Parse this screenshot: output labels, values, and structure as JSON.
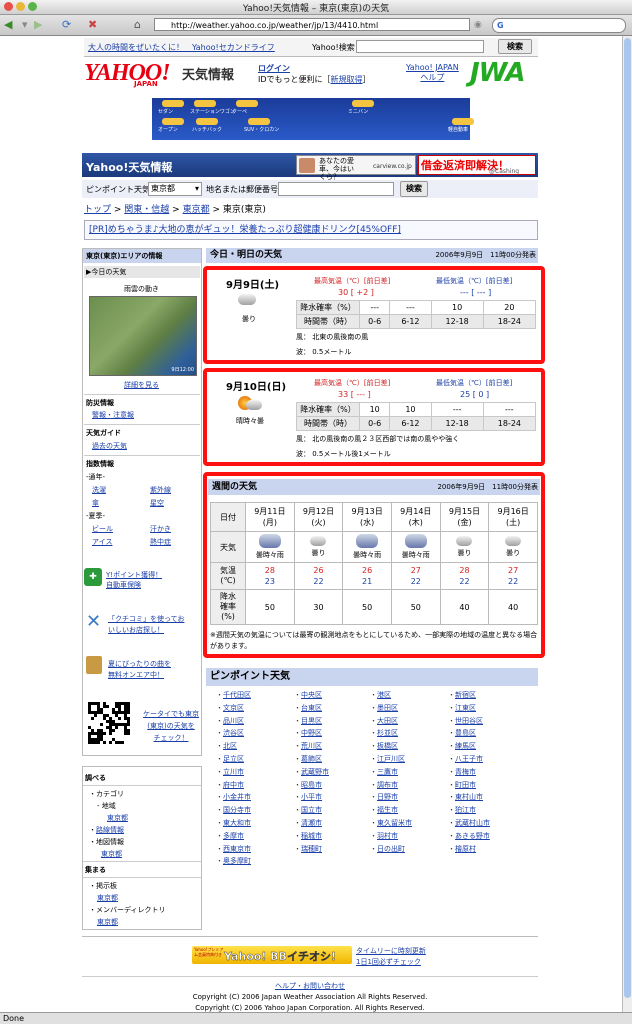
{
  "window": {
    "title": "Yahoo!天気情報 – 東京(東京)の天気",
    "url": "http://weather.yahoo.co.jp/weather/jp/13/4410.html"
  },
  "status": "Done",
  "top": {
    "link1": "大人の時間をぜいたくに！　Yahoo!セカンドライフ",
    "search_label": "Yahoo!検索",
    "search_button": "検索"
  },
  "header": {
    "logo": "YAHOO!",
    "logo_sub": "JAPAN",
    "service": "天気情報",
    "login": "ログイン",
    "login_sub": "IDでもっと便利に［",
    "signup": "新規取得",
    "login_end": "］",
    "links": [
      "Yahoo! JAPAN",
      "ヘルプ"
    ],
    "jwa": "JWA"
  },
  "banner_cars": [
    "セダン",
    "ステーションワゴン",
    "クーペ",
    "ミニバン",
    "オープン",
    "ハッチバック",
    "SUV・クロカン",
    "軽自動車"
  ],
  "bar": {
    "title": "Yahoo!天気情報",
    "ad1": "あなたの愛車、今はいくら？",
    "ad1_brand": "carview.co.jp",
    "ad2": "借金返済即解決！",
    "ad2_sub": "@Cashing"
  },
  "pinpoint": {
    "label": "ピンポイント天気",
    "select": "東京都",
    "search_label": "地名または郵便番号",
    "button": "検索"
  },
  "breadcrumb": [
    "トップ",
    "関東・信越",
    "東京都",
    "東京(東京)"
  ],
  "pr": "[PR]めちゃうま♪大地の恵がギュッ！栄養たっぷり超健康ドリンク[45%OFF]",
  "side": {
    "area_title": "東京(東京)エリアの情報",
    "today": "▶今日の天気",
    "cloud": "雨雲の動き",
    "radar_time": "9日12:00",
    "detail": "詳細を見る",
    "bousai": "防災情報",
    "keihou": "警報・注意報",
    "guide": "天気ガイド",
    "past": "過去の天気",
    "index": "指数情報",
    "year": "-通年-",
    "sentaku": "洗濯",
    "shigaisen": "紫外線",
    "kasa": "傘",
    "hoshizora": "星空",
    "summer": "-夏季-",
    "beer": "ビール",
    "asemo": "汗かき",
    "ice": "アイス",
    "necchu": "熱中症",
    "promo1a": "Y!ポイント獲得！",
    "promo1b": "自動車保険",
    "promo2a": "「クチコミ」を使ってお",
    "promo2b": "いしいお店探し！",
    "promo3a": "夏にぴったりの曲を",
    "promo3b": "無料オンエア中！",
    "qr_text1": "ケータイでも東京",
    "qr_text2": "(東京)の天気を",
    "qr_text3": "チェック！",
    "search_title": "調べる",
    "category": "・カテゴリ",
    "region": "- 地域",
    "tokyo1": "東京都",
    "rosen": "路線情報",
    "chizu": "地図情報",
    "tokyo2": "東京都",
    "gather": "集まる",
    "bbs": "・掲示板",
    "tokyo3": "東京都",
    "member": "・メンバーディレクトリ",
    "tokyo4": "東京都"
  },
  "today_header": {
    "title": "今日・明日の天気",
    "date": "2006年9月9日　11時00分発表"
  },
  "days": [
    {
      "date": "9月9日(土)",
      "weather": "曇り",
      "hi_label": "最高気温（℃）[前日差]",
      "hi": "30 [ +2 ]",
      "lo_label": "最低気温（℃）[前日差]",
      "lo": "--- [ --- ]",
      "rain_label": "降水確率（%）",
      "rain": [
        "---",
        "---",
        "10",
        "20"
      ],
      "time_label": "時間帯（時）",
      "times": [
        "0-6",
        "6-12",
        "12-18",
        "18-24"
      ],
      "wind": "風：  北東の風後南の風",
      "wave": "波：  0.5メートル"
    },
    {
      "date": "9月10日(日)",
      "weather": "晴時々曇",
      "hi_label": "最高気温（℃）[前日差]",
      "hi": "33 [ --- ]",
      "lo_label": "最低気温（℃）[前日差]",
      "lo": "25 [ 0 ]",
      "rain_label": "降水確率（%）",
      "rain": [
        "10",
        "10",
        "---",
        "---"
      ],
      "time_label": "時間帯（時）",
      "times": [
        "0-6",
        "6-12",
        "12-18",
        "18-24"
      ],
      "wind": "風：  北の風後南の風２３区西部では南の風やや強く",
      "wave": "波：  0.5メートル後1メートル"
    }
  ],
  "weekly": {
    "title": "週間の天気",
    "date": "2006年9月9日　11時00分発表",
    "row_date": "日付",
    "row_weather": "天気",
    "row_temp": "気温\n(℃)",
    "row_rain": "降水\n確率\n(%)",
    "days": [
      {
        "d": "9月11日",
        "w": "(月)",
        "wx": "曇時々雨",
        "hi": "28",
        "lo": "23",
        "rain": "50",
        "icon": "thunder"
      },
      {
        "d": "9月12日",
        "w": "(火)",
        "wx": "曇り",
        "hi": "26",
        "lo": "22",
        "rain": "30",
        "icon": "cloud"
      },
      {
        "d": "9月13日",
        "w": "(水)",
        "wx": "曇時々雨",
        "hi": "26",
        "lo": "21",
        "rain": "50",
        "icon": "thunder"
      },
      {
        "d": "9月14日",
        "w": "(木)",
        "wx": "曇時々雨",
        "hi": "27",
        "lo": "22",
        "rain": "50",
        "icon": "thunder"
      },
      {
        "d": "9月15日",
        "w": "(金)",
        "wx": "曇り",
        "hi": "28",
        "lo": "22",
        "rain": "40",
        "icon": "cloud"
      },
      {
        "d": "9月16日",
        "w": "(土)",
        "wx": "曇り",
        "hi": "27",
        "lo": "22",
        "rain": "40",
        "icon": "cloud"
      }
    ],
    "note": "※週間天気の気温については最寄の観測地点をもとにしているため、一部実際の地域の温度と異なる場合があります。"
  },
  "pin_header": "ピンポイント天気",
  "pin_cols": [
    [
      "千代田区",
      "文京区",
      "品川区",
      "渋谷区",
      "北区",
      "足立区",
      "立川市",
      "府中市",
      "小金井市",
      "国分寺市",
      "東大和市",
      "多摩市",
      "西東京市",
      "奥多摩町"
    ],
    [
      "中央区",
      "台東区",
      "目黒区",
      "中野区",
      "荒川区",
      "葛飾区",
      "武蔵野市",
      "昭島市",
      "小平市",
      "国立市",
      "清瀬市",
      "稲城市",
      "瑞穂町"
    ],
    [
      "港区",
      "墨田区",
      "大田区",
      "杉並区",
      "板橋区",
      "江戸川区",
      "三鷹市",
      "調布市",
      "日野市",
      "福生市",
      "東久留米市",
      "羽村市",
      "日の出町"
    ],
    [
      "新宿区",
      "江東区",
      "世田谷区",
      "豊島区",
      "練馬区",
      "八王子市",
      "青梅市",
      "町田市",
      "東村山市",
      "狛江市",
      "武蔵村山市",
      "あきる野市",
      "檜原村"
    ]
  ],
  "footer": {
    "bb": "Yahoo! BBイチオシ!",
    "bb_sub": "Yahoo!プレミアム会員特典付き",
    "bb_link1": "タイムリーに時刻更新",
    "bb_link2": "1日1回必ずチェック",
    "help": "ヘルプ・お問い合わせ",
    "copy1": "Copyright (C) 2006 Japan Weather Association All Rights Reserved.",
    "copy2": "Copyright (C) 2006 Yahoo Japan Corporation. All Rights Reserved."
  },
  "colors": {
    "link": "#1a3fa8",
    "red_frame": "#ff1010",
    "header_band": "#c9d4ee",
    "yahoo_red": "#e60012"
  }
}
